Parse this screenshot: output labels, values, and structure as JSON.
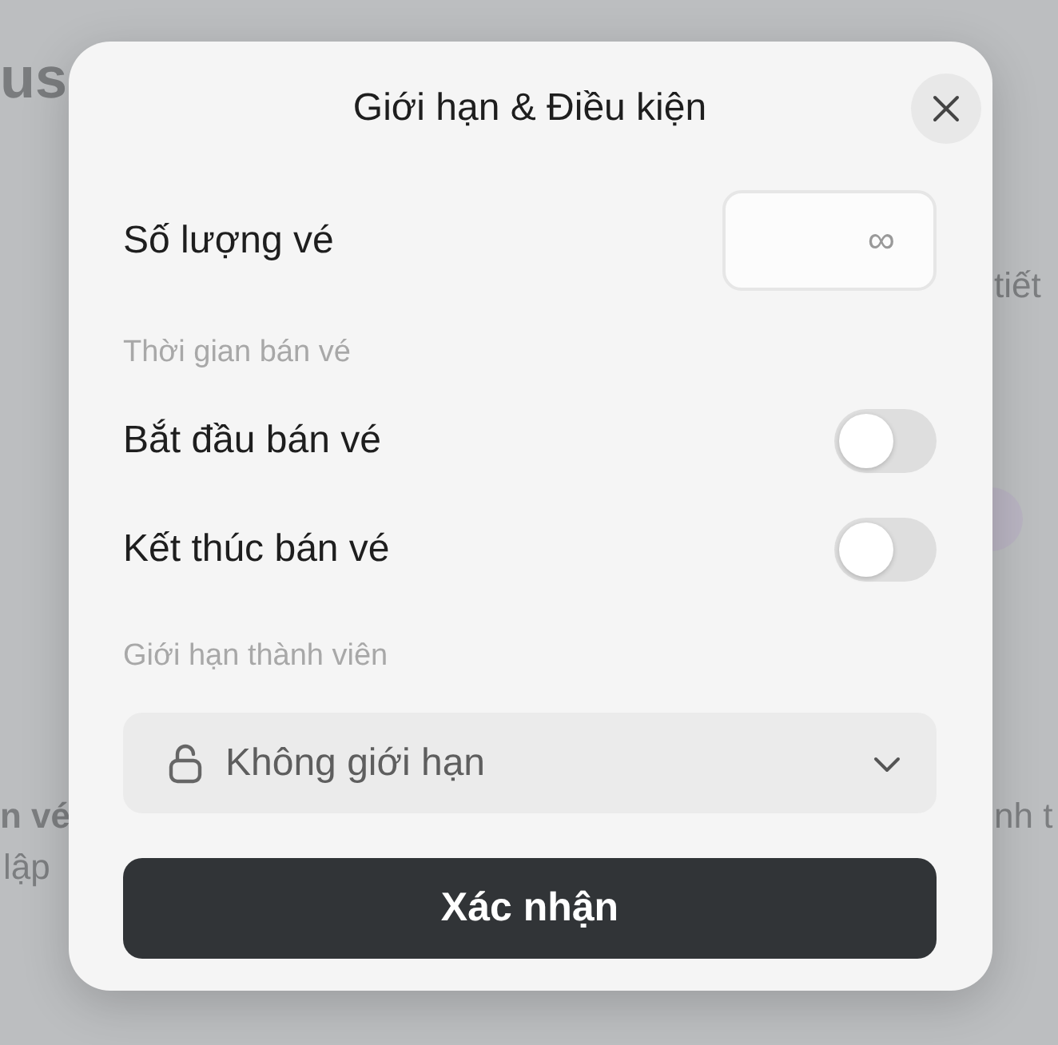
{
  "background": {
    "texts": [
      {
        "kind": "heading",
        "text": "us"
      },
      {
        "kind": "tab",
        "text": "tiết"
      },
      {
        "kind": "bold",
        "text": "n vé"
      },
      {
        "kind": "muted",
        "text": "lập"
      },
      {
        "kind": "muted-right",
        "text": "nh t"
      }
    ]
  },
  "dialog": {
    "title": "Giới hạn & Điều kiện",
    "quantity": {
      "label": "Số lượng vé",
      "placeholder": "∞"
    },
    "sections": [
      {
        "heading": "Thời gian bán vé",
        "toggles": [
          {
            "label": "Bắt đầu bán vé",
            "on": false
          },
          {
            "label": "Kết thúc bán vé",
            "on": false
          }
        ]
      }
    ],
    "member_limit": {
      "heading": "Giới hạn thành viên",
      "value": "Không giới hạn"
    },
    "confirm": "Xác nhận"
  }
}
